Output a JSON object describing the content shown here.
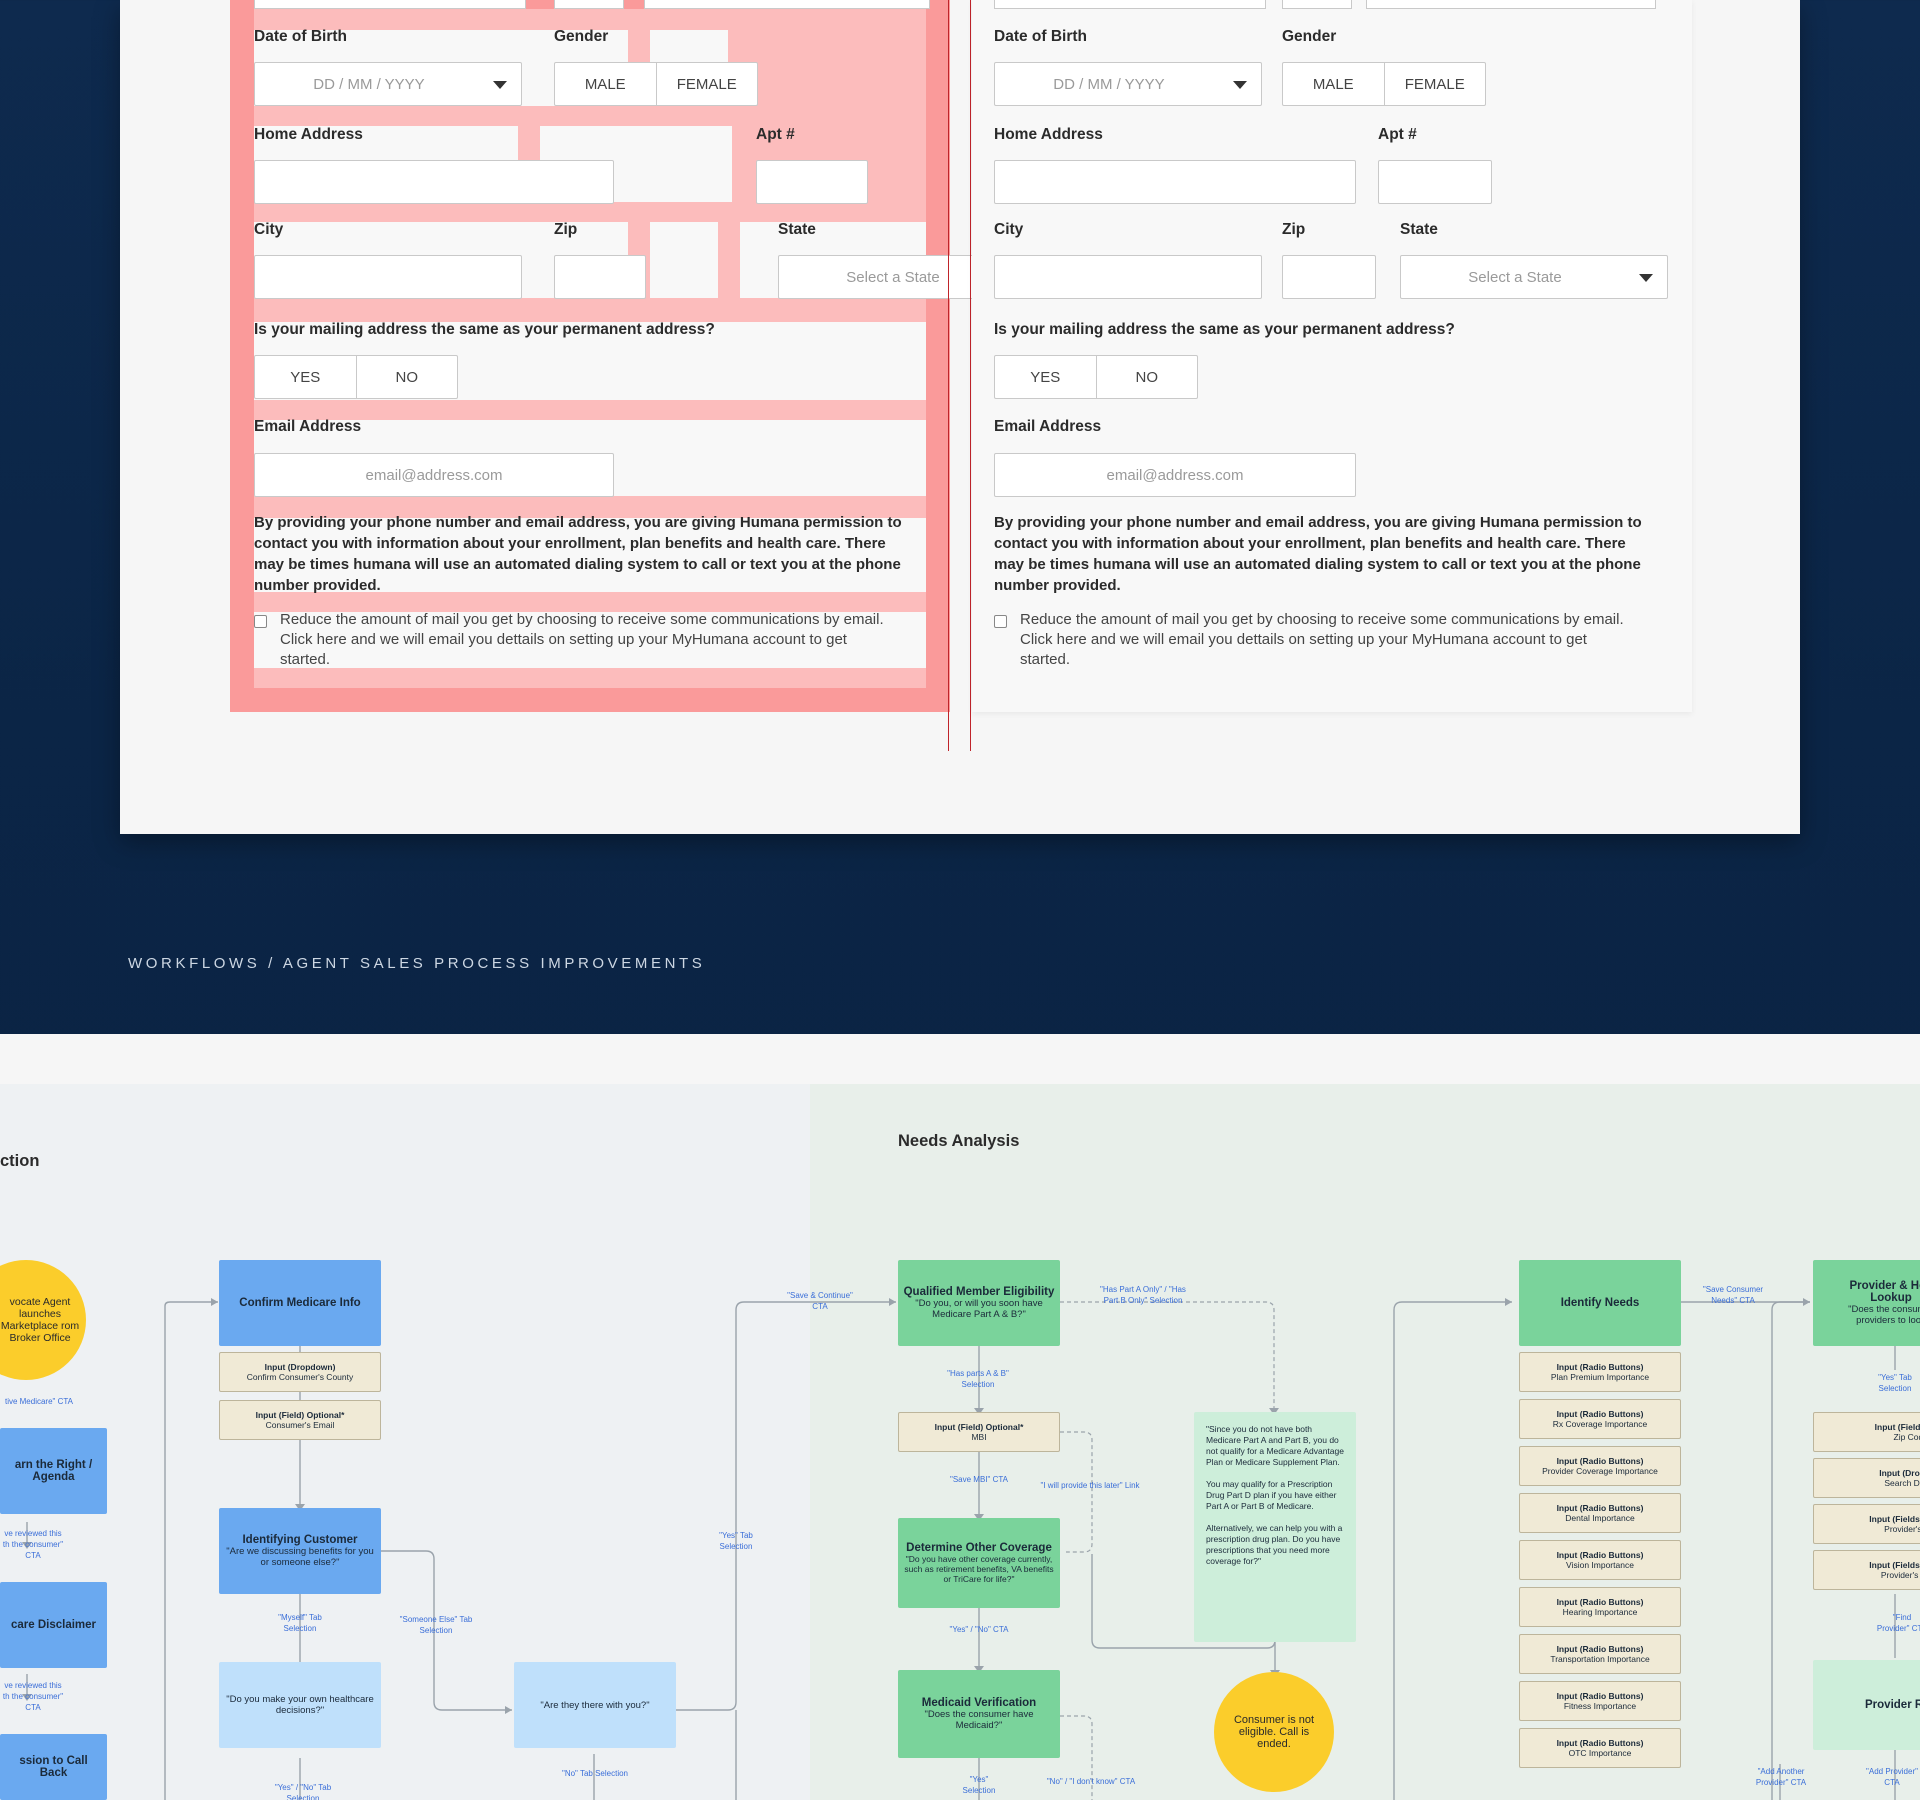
{
  "form": {
    "dob_label": "Date of Birth",
    "dob_placeholder": "DD / MM / YYYY",
    "gender_label": "Gender",
    "gender_male": "MALE",
    "gender_female": "FEMALE",
    "home_address_label": "Home Address",
    "apt_label": "Apt #",
    "city_label": "City",
    "zip_label": "Zip",
    "state_label": "State",
    "state_placeholder": "Select a State",
    "mailing_question": "Is your mailing address the same as your permanent address?",
    "yes": "YES",
    "no": "NO",
    "email_label": "Email Address",
    "email_placeholder": "email@address.com",
    "consent_text": "By providing your phone number and email address, you are giving Humana permission to contact you with information about your enrollment,  plan benefits and health care. There may be times humana will use an automated dialing system to call or text you at the phone number provided.",
    "checkbox_text": "Reduce the amount of mail you get by choosing to receive some communications by email. Click here and we will email you dettails on setting up your MyHumana account to get started."
  },
  "breadcrumb": "WORKFLOWS / AGENT SALES PROCESS IMPROVEMENTS",
  "workflow": {
    "section_left_title": "ction",
    "section_right_title": "Needs Analysis",
    "start_circle": "vocate Agent launches Marketplace rom Broker Office",
    "note_active_medicare": "tive Medicare\" CTA",
    "box_right_agenda": "arn the Right / Agenda",
    "note_reviewed_1": "ve reviewed this th the consumer\" CTA",
    "box_disclaimer": "care Disclaimer",
    "note_reviewed_2": "ve reviewed this th the consumer\" CTA",
    "box_call_back": "ssion to Call Back",
    "confirm_medicare": "Confirm Medicare Info",
    "input_dropdown": "Input (Dropdown)",
    "confirm_county": "Confirm Consumer's County",
    "input_field_optional": "Input (Field) Optional*",
    "consumer_email": "Consumer's Email",
    "identifying_customer": "Identifying Customer",
    "identifying_question": "\"Are we discussing benefits for you or someone else?\"",
    "note_myself": "\"Myself\" Tab Selection",
    "note_someone_else": "\"Someone Else\" Tab Selection",
    "own_decisions": "\"Do you make your own healthcare decisions?\"",
    "note_yes_no_1": "\"Yes\" / \"No\" Tab Selection",
    "there_with_you": "\"Are they there with you?\"",
    "note_no": "\"No\" Tab Selection",
    "note_yes_tab": "\"Yes\" Tab Selection",
    "note_save_continue": "\"Save & Continue\" CTA",
    "qualified_title": "Qualified Member Eligibility",
    "qualified_question": "\"Do you, or will you soon have Medicare Part A & B?\"",
    "note_part_a_only": "\"Has Part A Only\" / \"Has Part B Only\" Selection",
    "note_parts_ab": "\"Has parts A & B\" Selection",
    "input_field_mbi": "Input (Field) Optional*",
    "mbi": "MBI",
    "note_save_mbi": "\"Save MBI\" CTA",
    "note_provide_later": "\"I will provide this later\" Link",
    "other_coverage_title": "Determine Other Coverage",
    "other_coverage_q": "\"Do you have other coverage currently, such as retirement benefits, VA benefits or TriCare for life?\"",
    "note_yes_no_2": "\"Yes\" / \"No\" CTA",
    "medicaid_title": "Medicaid Verification",
    "medicaid_q": "\"Does the consumer have Medicaid?\"",
    "note_yes_sel": "\"Yes\" Selection",
    "note_no_dont_know": "\"No\" / \"I don't know\" CTA",
    "ineligible_text_1": "\"Since you do not have both Medicare Part A and Part B, you do not qualify for a Medicare Advantage Plan or Medicare Supplement Plan.",
    "ineligible_text_2": "You may qualify for a Prescription Drug Part D plan if you have either Part A or Part B of Medicare.",
    "ineligible_text_3": "Alternatively, we can help you with a prescription drug plan. Do you have prescriptions that you need more coverage for?\"",
    "not_eligible": "Consumer is not eligible. Call is ended.",
    "identify_needs": "Identify Needs",
    "note_save_needs": "\"Save Consumer Needs\" CTA",
    "radio_label": "Input (Radio Buttons)",
    "needs": [
      "Plan Premium Importance",
      "Rx Coverage Importance",
      "Provider Coverage Importance",
      "Dental Importance",
      "Vision Importance",
      "Hearing Importance",
      "Transportation Importance",
      "Fitness Importance",
      "OTC Importance"
    ],
    "provider_title": "Provider & Hos Lookup",
    "provider_q": "\"Does the consumer providers to look",
    "note_yes_tab_2": "\"Yes\" Tab Selection",
    "in_fields": "Input (Fields)",
    "zip_code": "Zip Code",
    "in_dropdown": "Input (Dropdow",
    "search_distance": "Search Distanc",
    "in_fields_opt_1": "Input (Fields) Opti",
    "providers_name": "Provider's Nam",
    "in_fields_opt_2": "Input (Fields) Opti",
    "providers_spec": "Provider's Speci",
    "note_find_provider": "\"Find Provider\" CTA",
    "provider_results": "Provider Resu",
    "note_add_another": "\"Add Another Provider\" CTA",
    "note_add_provider": "\"Add Provider\" CTA"
  }
}
